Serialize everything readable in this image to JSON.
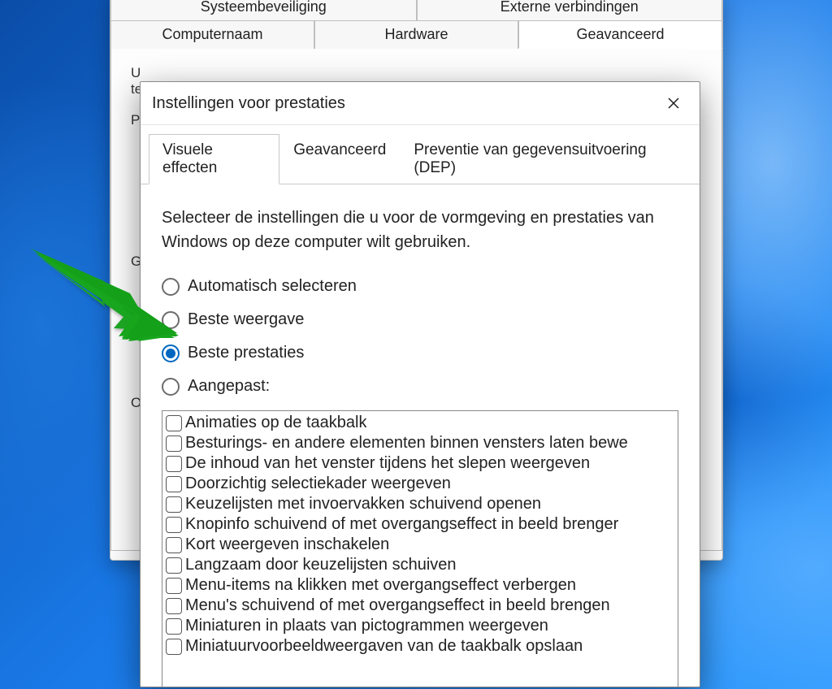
{
  "back_window": {
    "tabs_row1": [
      "Systeembeveiliging",
      "Externe verbindingen"
    ],
    "tabs_row2": [
      "Computernaam",
      "Hardware",
      "Geavanceerd"
    ],
    "active_tab": "Geavanceerd",
    "intro_line1": "U",
    "intro_line2": "te",
    "section_p": "P",
    "section_g": "G",
    "section_o": "O"
  },
  "front_window": {
    "title": "Instellingen voor prestaties",
    "tabs": [
      "Visuele effecten",
      "Geavanceerd",
      "Preventie van gegevensuitvoering (DEP)"
    ],
    "active_tab": "Visuele effecten",
    "intro": "Selecteer de instellingen die u voor de vormgeving en prestaties van Windows op deze computer wilt gebruiken.",
    "radios": [
      {
        "label": "Automatisch selecteren",
        "selected": false
      },
      {
        "label": "Beste weergave",
        "selected": false
      },
      {
        "label": "Beste prestaties",
        "selected": true
      },
      {
        "label": "Aangepast:",
        "selected": false
      }
    ],
    "checkboxes": [
      "Animaties op de taakbalk",
      "Besturings- en andere elementen binnen vensters laten bewe",
      "De inhoud van het venster tijdens het slepen weergeven",
      "Doorzichtig selectiekader weergeven",
      "Keuzelijsten met invoervakken schuivend openen",
      "Knopinfo schuivend of met overgangseffect in beeld brenger",
      "Kort weergeven inschakelen",
      "Langzaam door keuzelijsten schuiven",
      "Menu-items na klikken met overgangseffect verbergen",
      "Menu's schuivend of met overgangseffect in beeld brengen",
      "Miniaturen in plaats van pictogrammen weergeven",
      "Miniatuurvoorbeeldweergaven van de taakbalk opslaan"
    ]
  }
}
